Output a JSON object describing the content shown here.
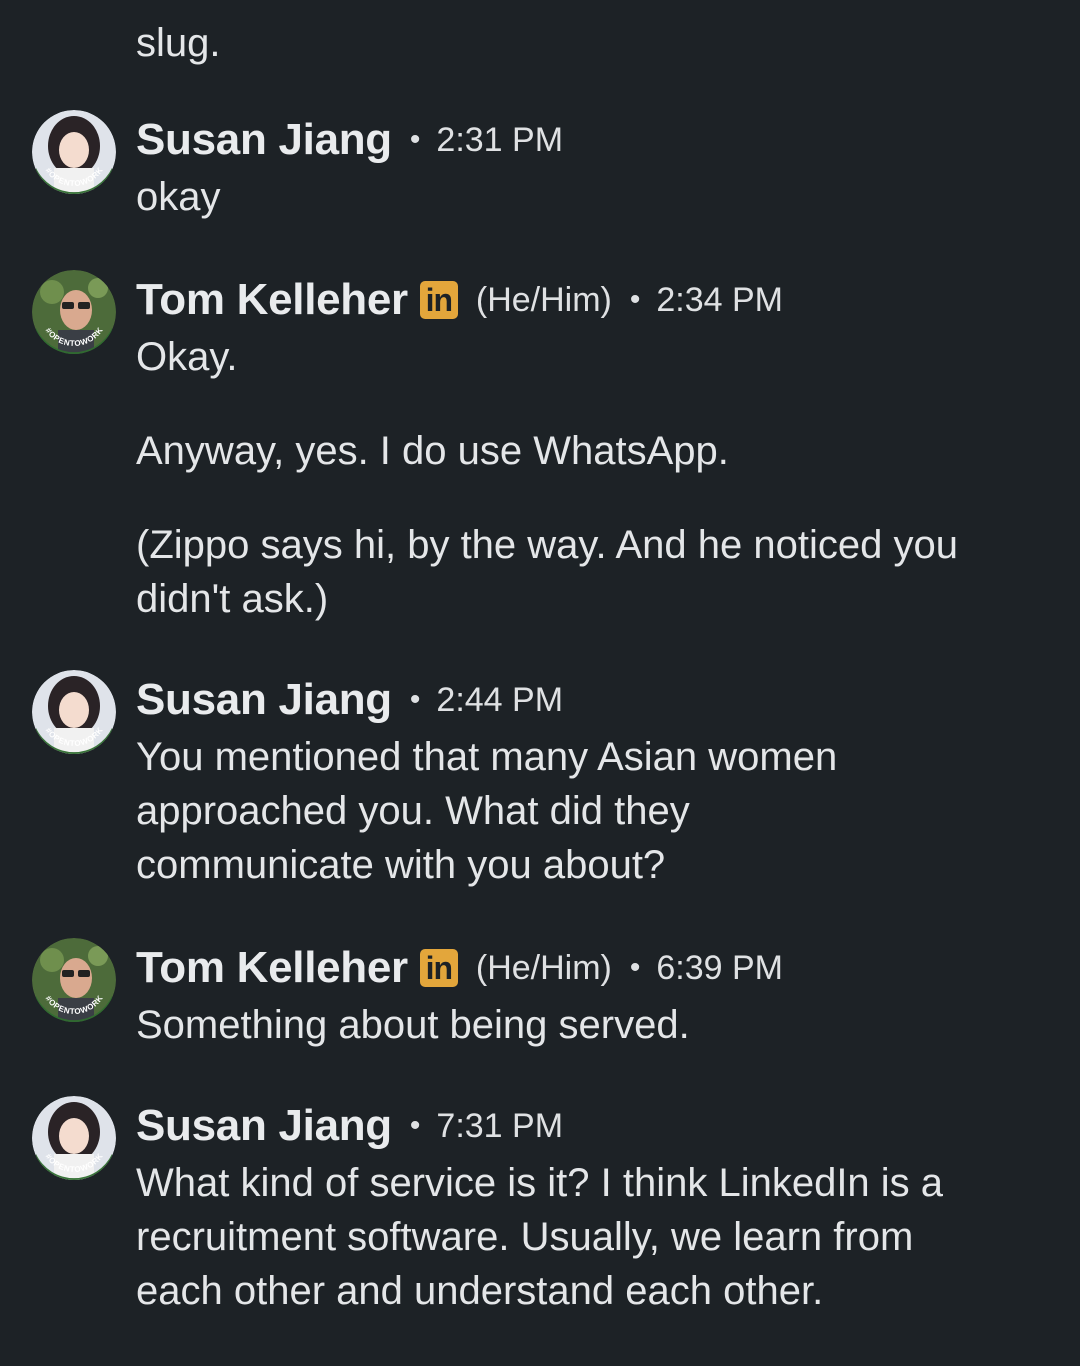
{
  "top_fragment": {
    "faded": "",
    "text": "slug."
  },
  "messages": [
    {
      "sender": "Susan Jiang",
      "time": "2:31 PM",
      "paragraphs": [
        "okay"
      ]
    },
    {
      "sender": "Tom Kelleher",
      "badge": "in",
      "pronouns": "(He/Him)",
      "time": "2:34 PM",
      "paragraphs": [
        "Okay.",
        "Anyway, yes.  I do use WhatsApp.",
        "(Zippo says hi, by the way.  And he noticed you didn't ask.)"
      ]
    },
    {
      "sender": "Susan Jiang",
      "time": "2:44 PM",
      "paragraphs": [
        "You mentioned that many Asian women approached you. What did they communicate with you about?"
      ]
    },
    {
      "sender": "Tom Kelleher",
      "badge": "in",
      "pronouns": "(He/Him)",
      "time": "6:39 PM",
      "paragraphs": [
        "Something about being served."
      ]
    },
    {
      "sender": "Susan Jiang",
      "time": "7:31 PM",
      "paragraphs": [
        "What kind of service is it? I think LinkedIn is a recruitment software. Usually, we learn from each other and understand each other."
      ]
    }
  ],
  "avatar_ring_text": "#OPENTOWORK",
  "separator": "•",
  "colors": {
    "background": "#1d2226",
    "text": "#e4e6e8",
    "linkedin_badge": "#e3a63b",
    "opentowork_ring": "#2f6d2f"
  }
}
